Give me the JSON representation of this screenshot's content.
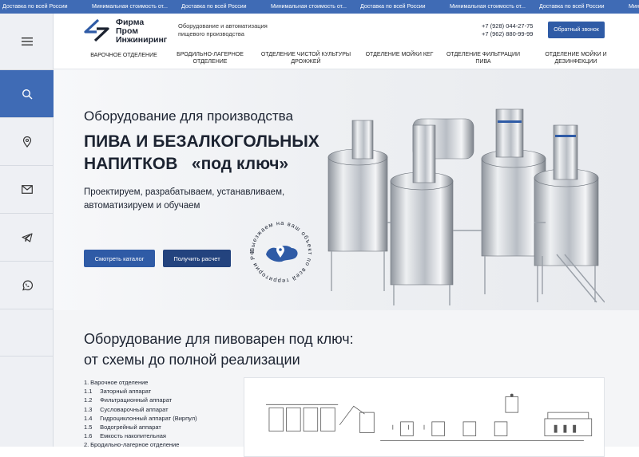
{
  "ticker": [
    "Доставка по всей России",
    "Минимальная стоимость от...",
    "Доставка по всей России",
    "Минимальная стоимость от...",
    "Доставка по всей России",
    "Минимальная стоимость от...",
    "Доставка по всей России",
    "Минимальная стоимость от..."
  ],
  "brand": {
    "line1": "Фирма",
    "line2": "Пром",
    "line3": "Инжиниринг",
    "tagline": "Оборудование и автоматизация пищевого производства",
    "phone1": "+7 (928) 044-27-75",
    "phone2": "+7 (962) 880-99-99",
    "callback_label": "Обратный звонок",
    "accent": "#2f5ba6"
  },
  "nav": [
    "Варочное отделение",
    "Бродильно-лагерное отделение",
    "Отделение чистой культуры дрожжей",
    "Отделение мойки кег",
    "Отделение фильтрации пива",
    "Отделение мойки и дезинфекции"
  ],
  "sidebar": {
    "icons": [
      "menu-icon",
      "search-icon",
      "location-icon",
      "mail-icon",
      "telegram-icon",
      "whatsapp-icon"
    ]
  },
  "hero": {
    "subtitle": "Оборудование для производства",
    "title_line1": "ПИВА И БЕЗАЛКОГОЛЬНЫХ",
    "title_line2": "НАПИТКОВ   «под ключ»",
    "text": "Проектируем, разрабатываем, устанавливаем, автоматизируем и обучаем",
    "btn_catalog": "Смотреть каталог",
    "btn_quote": "Получить расчет",
    "stamp_text": "Выезжаем на ваш объект по всей территории РФ"
  },
  "section": {
    "title_line1": "Оборудование для пивоварен под ключ:",
    "title_line2": "от схемы до полной реализации",
    "list": [
      {
        "num": "1.",
        "text": "Варочное отделение"
      },
      {
        "num": "1.1",
        "text": "Заторный аппарат"
      },
      {
        "num": "1.2",
        "text": "Фильтрационный аппарат"
      },
      {
        "num": "1.3",
        "text": "Сусловарочный аппарат"
      },
      {
        "num": "1.4",
        "text": "Гидроциклонный аппарат (Вирпул)"
      },
      {
        "num": "1.5",
        "text": "Водогрейный аппарат"
      },
      {
        "num": "1.6",
        "text": "Емкость накопительная"
      },
      {
        "num": "2.",
        "text": "Бродильно-лагерное отделение"
      }
    ]
  }
}
